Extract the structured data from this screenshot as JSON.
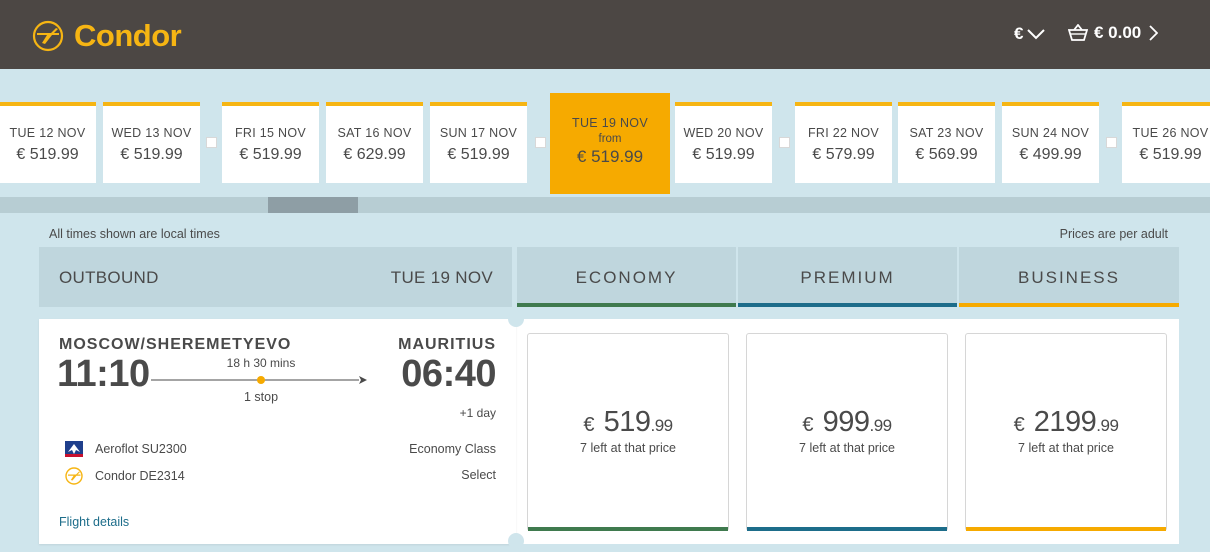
{
  "header": {
    "brand": "Condor",
    "currency_symbol": "€",
    "basket_value": "€ 0.00"
  },
  "dates": [
    {
      "day": "TUE 12 NOV",
      "price": "€ 519.99"
    },
    {
      "day": "WED 13 NOV",
      "price": "€ 519.99"
    },
    {
      "day": "FRI 15 NOV",
      "price": "€ 519.99"
    },
    {
      "day": "SAT 16 NOV",
      "price": "€ 629.99"
    },
    {
      "day": "SUN 17 NOV",
      "price": "€ 519.99"
    },
    {
      "day": "TUE 19 NOV",
      "from": "from",
      "price": "€ 519.99"
    },
    {
      "day": "WED 20 NOV",
      "price": "€ 519.99"
    },
    {
      "day": "FRI 22 NOV",
      "price": "€ 579.99"
    },
    {
      "day": "SAT 23 NOV",
      "price": "€ 569.99"
    },
    {
      "day": "SUN 24 NOV",
      "price": "€ 499.99"
    },
    {
      "day": "TUE 26 NOV",
      "price": "€ 519.99"
    }
  ],
  "notes": {
    "local_times": "All times shown are local times",
    "per_adult": "Prices are per adult"
  },
  "outbound": {
    "label": "OUTBOUND",
    "date": "TUE 19 NOV"
  },
  "classes": [
    {
      "label": "ECONOMY",
      "color": "#3f7a4e"
    },
    {
      "label": "PREMIUM",
      "color": "#1d6d8a"
    },
    {
      "label": "BUSINESS",
      "color": "#f6aa00"
    }
  ],
  "flight": {
    "departure_city": "MOSCOW/SHEREMETYEVO",
    "departure_time": "11:10",
    "arrival_city": "MAURITIUS",
    "arrival_time": "06:40",
    "duration": "18 h 30 mins",
    "stops": "1 stop",
    "day_offset": "+1 day",
    "carriers": [
      {
        "name": "Aeroflot SU2300",
        "icon": "aeroflot-logo-icon"
      },
      {
        "name": "Condor DE2314",
        "icon": "condor-logo-icon"
      }
    ],
    "cabin": "Economy Class",
    "select": "Select",
    "details_link": "Flight details"
  },
  "fares": [
    {
      "currency": "€",
      "main": "519",
      "cents": ".99",
      "availability": "7 left at that price"
    },
    {
      "currency": "€",
      "main": "999",
      "cents": ".99",
      "availability": "7 left at that price"
    },
    {
      "currency": "€",
      "main": "2199",
      "cents": ".99",
      "availability": "7 left at that price"
    }
  ],
  "colors": {
    "header_bg": "#4c4744",
    "brand": "#f6b513",
    "selected_date": "#f6aa00",
    "page_bg": "#cfe5ec"
  }
}
